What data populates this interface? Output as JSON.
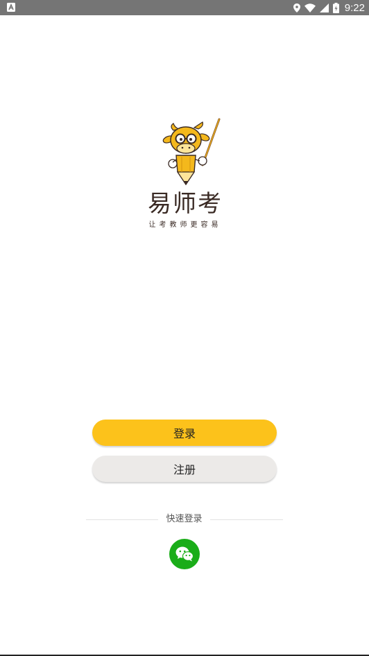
{
  "status_bar": {
    "time": "9:22",
    "left_icon": "notification-a-icon",
    "icons": [
      "location-icon",
      "wifi-icon",
      "cell-signal-icon",
      "battery-icon"
    ]
  },
  "brand": {
    "name": "易师考",
    "slogan": "让考教师更容易",
    "mascot_icon": "cow-mascot-icon",
    "accent_color": "#fcc21b"
  },
  "actions": {
    "login_label": "登录",
    "register_label": "注册"
  },
  "quick_login": {
    "label": "快速登录",
    "wechat_icon": "wechat-icon",
    "wechat_color": "#1aad19"
  }
}
